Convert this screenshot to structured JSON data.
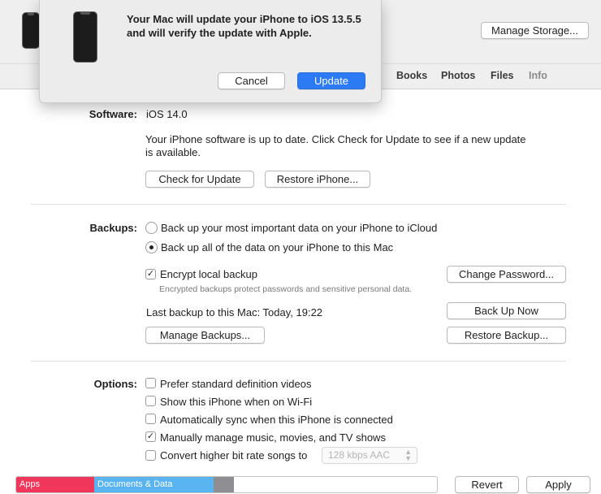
{
  "header": {
    "manage_storage_label": "Manage Storage...",
    "tabs": [
      "Books",
      "Photos",
      "Files",
      "Info"
    ]
  },
  "dialog": {
    "message": "Your Mac will update your iPhone to iOS 13.5.5 and will verify the update with Apple.",
    "cancel_label": "Cancel",
    "update_label": "Update"
  },
  "software": {
    "label": "Software:",
    "version": "iOS 14.0",
    "status_line1": "Your iPhone software is up to date. Click Check for Update to see if a new update",
    "status_line2": "is available.",
    "check_label": "Check for Update",
    "restore_label": "Restore iPhone..."
  },
  "backups": {
    "label": "Backups:",
    "option_icloud": "Back up your most important data on your iPhone to iCloud",
    "option_mac": "Back up all of the data on your iPhone to this Mac",
    "selected": "mac",
    "encrypt_label": "Encrypt local backup",
    "encrypt_checked": true,
    "encrypt_note": "Encrypted backups protect passwords and sensitive personal data.",
    "change_password_label": "Change Password...",
    "last_backup": "Last backup to this Mac:  Today, 19:22",
    "back_up_now_label": "Back Up Now",
    "manage_label": "Manage Backups...",
    "restore_backup_label": "Restore Backup..."
  },
  "options": {
    "label": "Options:",
    "items": [
      {
        "label": "Prefer standard definition videos",
        "checked": false
      },
      {
        "label": "Show this iPhone when on Wi-Fi",
        "checked": false
      },
      {
        "label": "Automatically sync when this iPhone is connected",
        "checked": false
      },
      {
        "label": "Manually manage music, movies, and TV shows",
        "checked": true
      },
      {
        "label": "Convert higher bit rate songs to",
        "checked": false
      }
    ],
    "bitrate_value": "128 kbps AAC"
  },
  "storage": {
    "segments": [
      {
        "label": "Apps",
        "color": "#f0365a"
      },
      {
        "label": "Documents & Data",
        "color": "#5ab4f0"
      },
      {
        "label": "",
        "color": "#8e8e93"
      }
    ]
  },
  "footer": {
    "revert_label": "Revert",
    "apply_label": "Apply"
  }
}
